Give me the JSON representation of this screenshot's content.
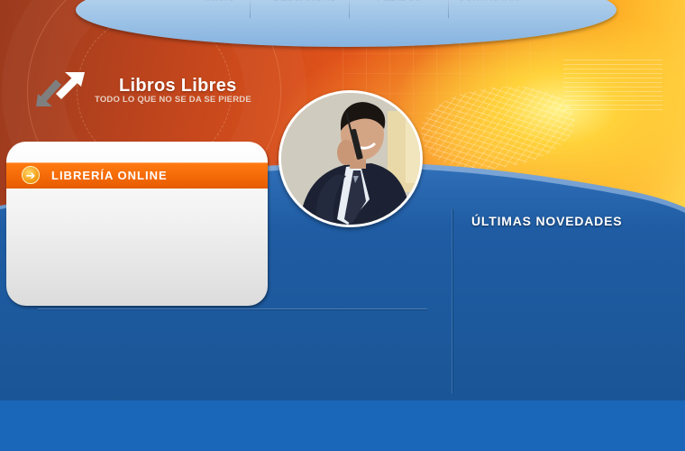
{
  "site": {
    "title": "Libros Libres",
    "tagline": "TODO LO QUE NO SE DA SE PIERDE",
    "logo_icon": "arrows-exchange-icon"
  },
  "nav": {
    "items": [
      {
        "label": "INICIO"
      },
      {
        "label": "DESCARGAS"
      },
      {
        "label": "PEDIDOS"
      },
      {
        "label": "CONTACTAR"
      }
    ]
  },
  "left_panel": {
    "title": "LIBRERÍA ONLINE",
    "icon": "arrow-right-circle-icon"
  },
  "photo": {
    "description_icon": "businessman-on-phone-photo"
  },
  "news": {
    "title": "ÚLTIMAS NOVEDADES"
  },
  "colors": {
    "accent_orange": "#f26806",
    "brand_blue": "#1a5596",
    "nav_blue": "#a9cbea"
  }
}
